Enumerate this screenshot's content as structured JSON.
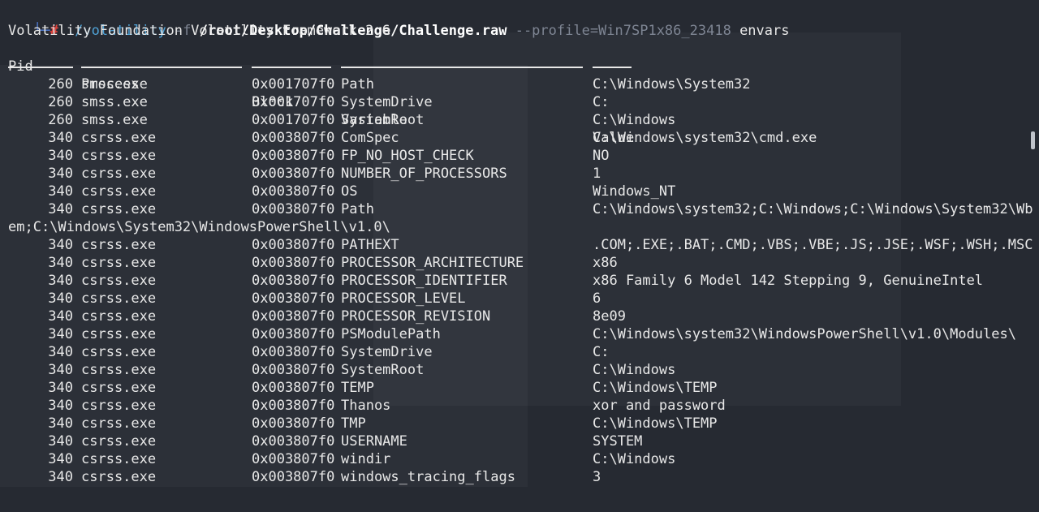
{
  "prompt": {
    "corner": "└─",
    "hash": "#",
    "command": "./volatility",
    "flag_f": "-f",
    "file_path": "/root/Desktop/Challenge/Challenge.raw",
    "profile_arg": "--profile=Win7SP1x86_23418",
    "plugin": "envars"
  },
  "banner": "Volatility Foundation Volatility Framework 2.6",
  "table": {
    "headers": {
      "pid": "Pid",
      "process": "Process",
      "block": "Block",
      "variable": "Variable",
      "value": "Value"
    },
    "rows": [
      {
        "pid": "260",
        "process": "smss.exe",
        "block": "0x001707f0",
        "variable": "Path",
        "value": "C:\\Windows\\System32"
      },
      {
        "pid": "260",
        "process": "smss.exe",
        "block": "0x001707f0",
        "variable": "SystemDrive",
        "value": "C:"
      },
      {
        "pid": "260",
        "process": "smss.exe",
        "block": "0x001707f0",
        "variable": "SystemRoot",
        "value": "C:\\Windows"
      },
      {
        "pid": "340",
        "process": "csrss.exe",
        "block": "0x003807f0",
        "variable": "ComSpec",
        "value": "C:\\Windows\\system32\\cmd.exe"
      },
      {
        "pid": "340",
        "process": "csrss.exe",
        "block": "0x003807f0",
        "variable": "FP_NO_HOST_CHECK",
        "value": "NO"
      },
      {
        "pid": "340",
        "process": "csrss.exe",
        "block": "0x003807f0",
        "variable": "NUMBER_OF_PROCESSORS",
        "value": "1"
      },
      {
        "pid": "340",
        "process": "csrss.exe",
        "block": "0x003807f0",
        "variable": "OS",
        "value": "Windows_NT"
      },
      {
        "pid": "340",
        "process": "csrss.exe",
        "block": "0x003807f0",
        "variable": "Path",
        "value": "C:\\Windows\\system32;C:\\Windows;C:\\Windows\\System32\\Wb"
      },
      {
        "wrap": "em;C:\\Windows\\System32\\WindowsPowerShell\\v1.0\\"
      },
      {
        "pid": "340",
        "process": "csrss.exe",
        "block": "0x003807f0",
        "variable": "PATHEXT",
        "value": ".COM;.EXE;.BAT;.CMD;.VBS;.VBE;.JS;.JSE;.WSF;.WSH;.MSC"
      },
      {
        "pid": "340",
        "process": "csrss.exe",
        "block": "0x003807f0",
        "variable": "PROCESSOR_ARCHITECTURE",
        "value": "x86"
      },
      {
        "pid": "340",
        "process": "csrss.exe",
        "block": "0x003807f0",
        "variable": "PROCESSOR_IDENTIFIER",
        "value": "x86 Family 6 Model 142 Stepping 9, GenuineIntel"
      },
      {
        "pid": "340",
        "process": "csrss.exe",
        "block": "0x003807f0",
        "variable": "PROCESSOR_LEVEL",
        "value": "6"
      },
      {
        "pid": "340",
        "process": "csrss.exe",
        "block": "0x003807f0",
        "variable": "PROCESSOR_REVISION",
        "value": "8e09"
      },
      {
        "pid": "340",
        "process": "csrss.exe",
        "block": "0x003807f0",
        "variable": "PSModulePath",
        "value": "C:\\Windows\\system32\\WindowsPowerShell\\v1.0\\Modules\\"
      },
      {
        "pid": "340",
        "process": "csrss.exe",
        "block": "0x003807f0",
        "variable": "SystemDrive",
        "value": "C:"
      },
      {
        "pid": "340",
        "process": "csrss.exe",
        "block": "0x003807f0",
        "variable": "SystemRoot",
        "value": "C:\\Windows"
      },
      {
        "pid": "340",
        "process": "csrss.exe",
        "block": "0x003807f0",
        "variable": "TEMP",
        "value": "C:\\Windows\\TEMP"
      },
      {
        "pid": "340",
        "process": "csrss.exe",
        "block": "0x003807f0",
        "variable": "Thanos",
        "value": "xor and password"
      },
      {
        "pid": "340",
        "process": "csrss.exe",
        "block": "0x003807f0",
        "variable": "TMP",
        "value": "C:\\Windows\\TEMP"
      },
      {
        "pid": "340",
        "process": "csrss.exe",
        "block": "0x003807f0",
        "variable": "USERNAME",
        "value": "SYSTEM"
      },
      {
        "pid": "340",
        "process": "csrss.exe",
        "block": "0x003807f0",
        "variable": "windir",
        "value": "C:\\Windows"
      },
      {
        "pid": "340",
        "process": "csrss.exe",
        "block": "0x003807f0",
        "variable": "windows_tracing_flags",
        "value": "3"
      }
    ]
  }
}
